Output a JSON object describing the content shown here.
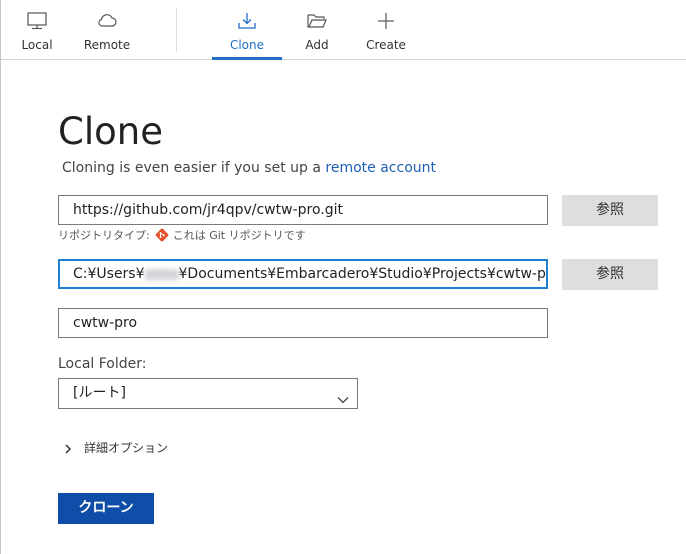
{
  "toolbar": {
    "items": [
      {
        "label": "Local",
        "icon": "monitor-icon"
      },
      {
        "label": "Remote",
        "icon": "cloud-icon"
      },
      {
        "label": "Clone",
        "icon": "download-icon",
        "active": true
      },
      {
        "label": "Add",
        "icon": "folder-open-icon"
      },
      {
        "label": "Create",
        "icon": "plus-icon"
      }
    ]
  },
  "main": {
    "title": "Clone",
    "subtitle_prefix": "Cloning is even easier if you set up a",
    "subtitle_link": "remote account",
    "url_field": {
      "value": "https://github.com/jr4qpv/cwtw-pro.git"
    },
    "browse_label": "参照",
    "repo_type_label": "リポジトリタイプ:",
    "repo_type_value": "これは Git リポジトリです",
    "path_field": {
      "value_prefix": "C:¥Users¥",
      "value_suffix": "¥Documents¥Embarcadero¥Studio¥Projects¥cwtw-pro"
    },
    "name_field": {
      "value": "cwtw-pro"
    },
    "local_folder_label": "Local Folder:",
    "local_folder_value": "[ルート]",
    "advanced_label": "詳細オプション",
    "clone_button_label": "クローン"
  },
  "colors": {
    "accent": "#1f6fc5",
    "primary_button": "#0f4ea8",
    "git_icon": "#e6522c",
    "browse_button_bg": "#dedede"
  }
}
